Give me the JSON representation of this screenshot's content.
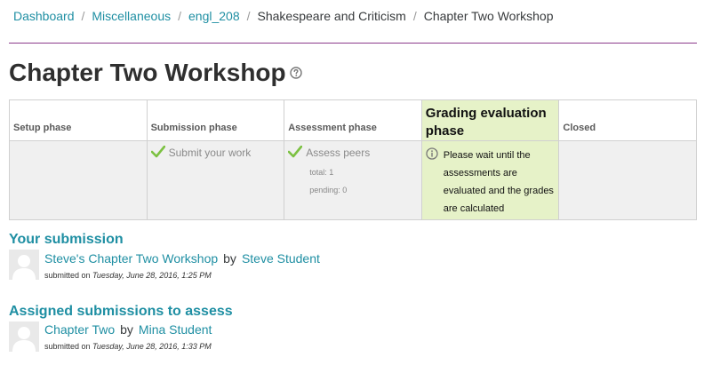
{
  "breadcrumb": {
    "items": [
      {
        "label": "Dashboard"
      },
      {
        "label": "Miscellaneous"
      },
      {
        "label": "engl_208"
      },
      {
        "label": "Shakespeare and Criticism"
      },
      {
        "label": "Chapter Two Workshop"
      }
    ],
    "separator": "/"
  },
  "page": {
    "title": "Chapter Two Workshop",
    "help_icon": "help-circle-icon"
  },
  "phases": [
    {
      "name": "Setup phase"
    },
    {
      "name": "Submission phase",
      "task": "Submit your work"
    },
    {
      "name": "Assessment phase",
      "task": "Assess peers",
      "total": "total: 1",
      "pending": "pending: 0"
    },
    {
      "name": "Grading evaluation phase",
      "info": "Please wait until the assessments are evaluated and the grades are calculated"
    },
    {
      "name": "Closed"
    }
  ],
  "your_submission": {
    "heading": "Your submission",
    "title": "Steve's Chapter Two Workshop",
    "by": "by",
    "author": "Steve Student",
    "submitted_prefix": "submitted on",
    "submitted_date": "Tuesday, June 28, 2016, 1:25 PM"
  },
  "assigned": {
    "heading": "Assigned submissions to assess",
    "title": "Chapter Two",
    "by": "by",
    "author": "Mina Student",
    "submitted_prefix": "submitted on",
    "submitted_date": "Tuesday, June 28, 2016, 1:33 PM"
  },
  "colors": {
    "link": "#1f8fa3",
    "active_phase": "#e6f2c8",
    "check": "#7cc142",
    "rule": "#8c3a8c"
  }
}
